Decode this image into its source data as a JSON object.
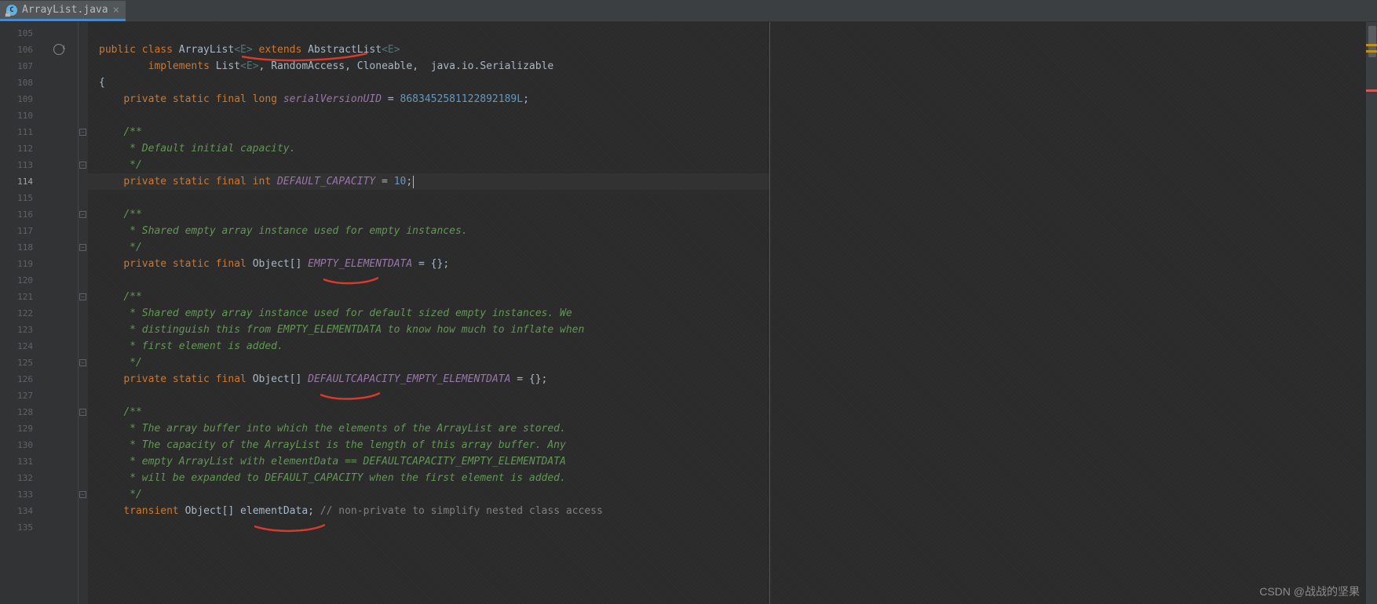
{
  "tab": {
    "filename": "ArrayList.java",
    "close": "×"
  },
  "lines": {
    "start": 105,
    "current": 114,
    "rows": [
      {
        "n": 105,
        "html": ""
      },
      {
        "n": 106,
        "html": "<span class='kw'>public class</span> <span class='cls'>ArrayList</span><span class='gen'>&lt;E&gt;</span> <span class='kw'>extends</span> <span class='cls'>AbstractList</span><span class='gen'>&lt;E&gt;</span>"
      },
      {
        "n": 107,
        "html": "        <span class='kw'>implements</span> <span class='cls'>List</span><span class='gen'>&lt;E&gt;</span><span class='pl'>,</span> <span class='cls'>RandomAccess</span><span class='pl'>,</span> <span class='cls'>Cloneable</span><span class='pl'>,</span>  <span class='cls'>java.io.Serializable</span>"
      },
      {
        "n": 108,
        "html": "<span class='pl'>{</span>"
      },
      {
        "n": 109,
        "html": "    <span class='kw'>private static final long</span> <span class='str-field'>serialVersionUID</span> <span class='pl'>=</span> <span class='num'>8683452581122892189L</span><span class='pl'>;</span>"
      },
      {
        "n": 110,
        "html": ""
      },
      {
        "n": 111,
        "html": "    <span class='com'>/**</span>"
      },
      {
        "n": 112,
        "html": "    <span class='com'> * Default initial capacity.</span>"
      },
      {
        "n": 113,
        "html": "    <span class='com'> */</span>"
      },
      {
        "n": 114,
        "html": "    <span class='kw'>private static final int</span> <span class='str-field'>DEFAULT_CAPACITY</span> <span class='pl'>=</span> <span class='num'>10</span><span class='pl'>;</span><span class='cursor'></span>"
      },
      {
        "n": 115,
        "html": ""
      },
      {
        "n": 116,
        "html": "    <span class='com'>/**</span>"
      },
      {
        "n": 117,
        "html": "    <span class='com'> * Shared empty array instance used for empty instances.</span>"
      },
      {
        "n": 118,
        "html": "    <span class='com'> */</span>"
      },
      {
        "n": 119,
        "html": "    <span class='kw'>private static final</span> <span class='cls'>Object</span><span class='pl'>[]</span> <span class='str-field'>EMPTY_ELEMENTDATA</span> <span class='pl'>= {};</span>"
      },
      {
        "n": 120,
        "html": ""
      },
      {
        "n": 121,
        "html": "    <span class='com'>/**</span>"
      },
      {
        "n": 122,
        "html": "    <span class='com'> * Shared empty array instance used for default sized empty instances. We</span>"
      },
      {
        "n": 123,
        "html": "    <span class='com'> * distinguish this from EMPTY_ELEMENTDATA to know how much to inflate when</span>"
      },
      {
        "n": 124,
        "html": "    <span class='com'> * first element is added.</span>"
      },
      {
        "n": 125,
        "html": "    <span class='com'> */</span>"
      },
      {
        "n": 126,
        "html": "    <span class='kw'>private static final</span> <span class='cls'>Object</span><span class='pl'>[]</span> <span class='str-field'>DEFAULTCAPACITY_EMPTY_ELEMENTDATA</span> <span class='pl'>= {};</span>"
      },
      {
        "n": 127,
        "html": ""
      },
      {
        "n": 128,
        "html": "    <span class='com'>/**</span>"
      },
      {
        "n": 129,
        "html": "    <span class='com'> * The array buffer into which the elements of the ArrayList are stored.</span>"
      },
      {
        "n": 130,
        "html": "    <span class='com'> * The capacity of the ArrayList is the length of this array buffer. Any</span>"
      },
      {
        "n": 131,
        "html": "    <span class='com'> * empty ArrayList with elementData == DEFAULTCAPACITY_EMPTY_ELEMENTDATA</span>"
      },
      {
        "n": 132,
        "html": "    <span class='com'> * will be expanded to DEFAULT_CAPACITY when the first element is added.</span>"
      },
      {
        "n": 133,
        "html": "    <span class='com'> */</span>"
      },
      {
        "n": 134,
        "html": "    <span class='kw'>transient</span> <span class='cls'>Object</span><span class='pl'>[]</span> <span class='fn'>elementData</span><span class='pl'>;</span> <span class='com-gray'>// non-private to simplify nested class access</span>"
      },
      {
        "n": 135,
        "html": ""
      }
    ]
  },
  "folds": [
    111,
    113,
    116,
    118,
    121,
    125,
    128,
    133
  ],
  "watermark": "CSDN @战战的坚果"
}
